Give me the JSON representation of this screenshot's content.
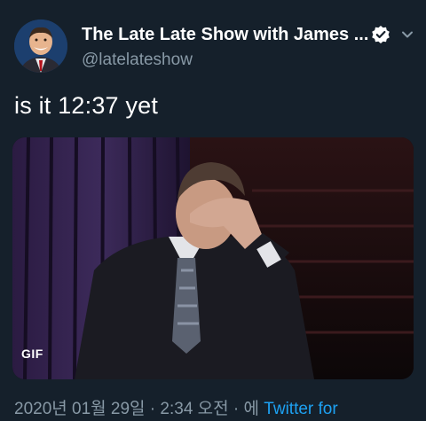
{
  "tweet": {
    "display_name": "The Late Late Show with James ...",
    "handle": "@latelateshow",
    "text": "is it 12:37 yet",
    "media_badge": "GIF",
    "timestamp": "2020년 01월 29일 · 2:34 오전 · 에",
    "source": "Twitter for"
  },
  "icons": {
    "avatar": "avatar",
    "verified": "verified-badge-icon",
    "menu": "chevron-down-icon"
  },
  "colors": {
    "background": "#15202b",
    "secondary_text": "#8899a6",
    "link": "#1da1f2"
  }
}
